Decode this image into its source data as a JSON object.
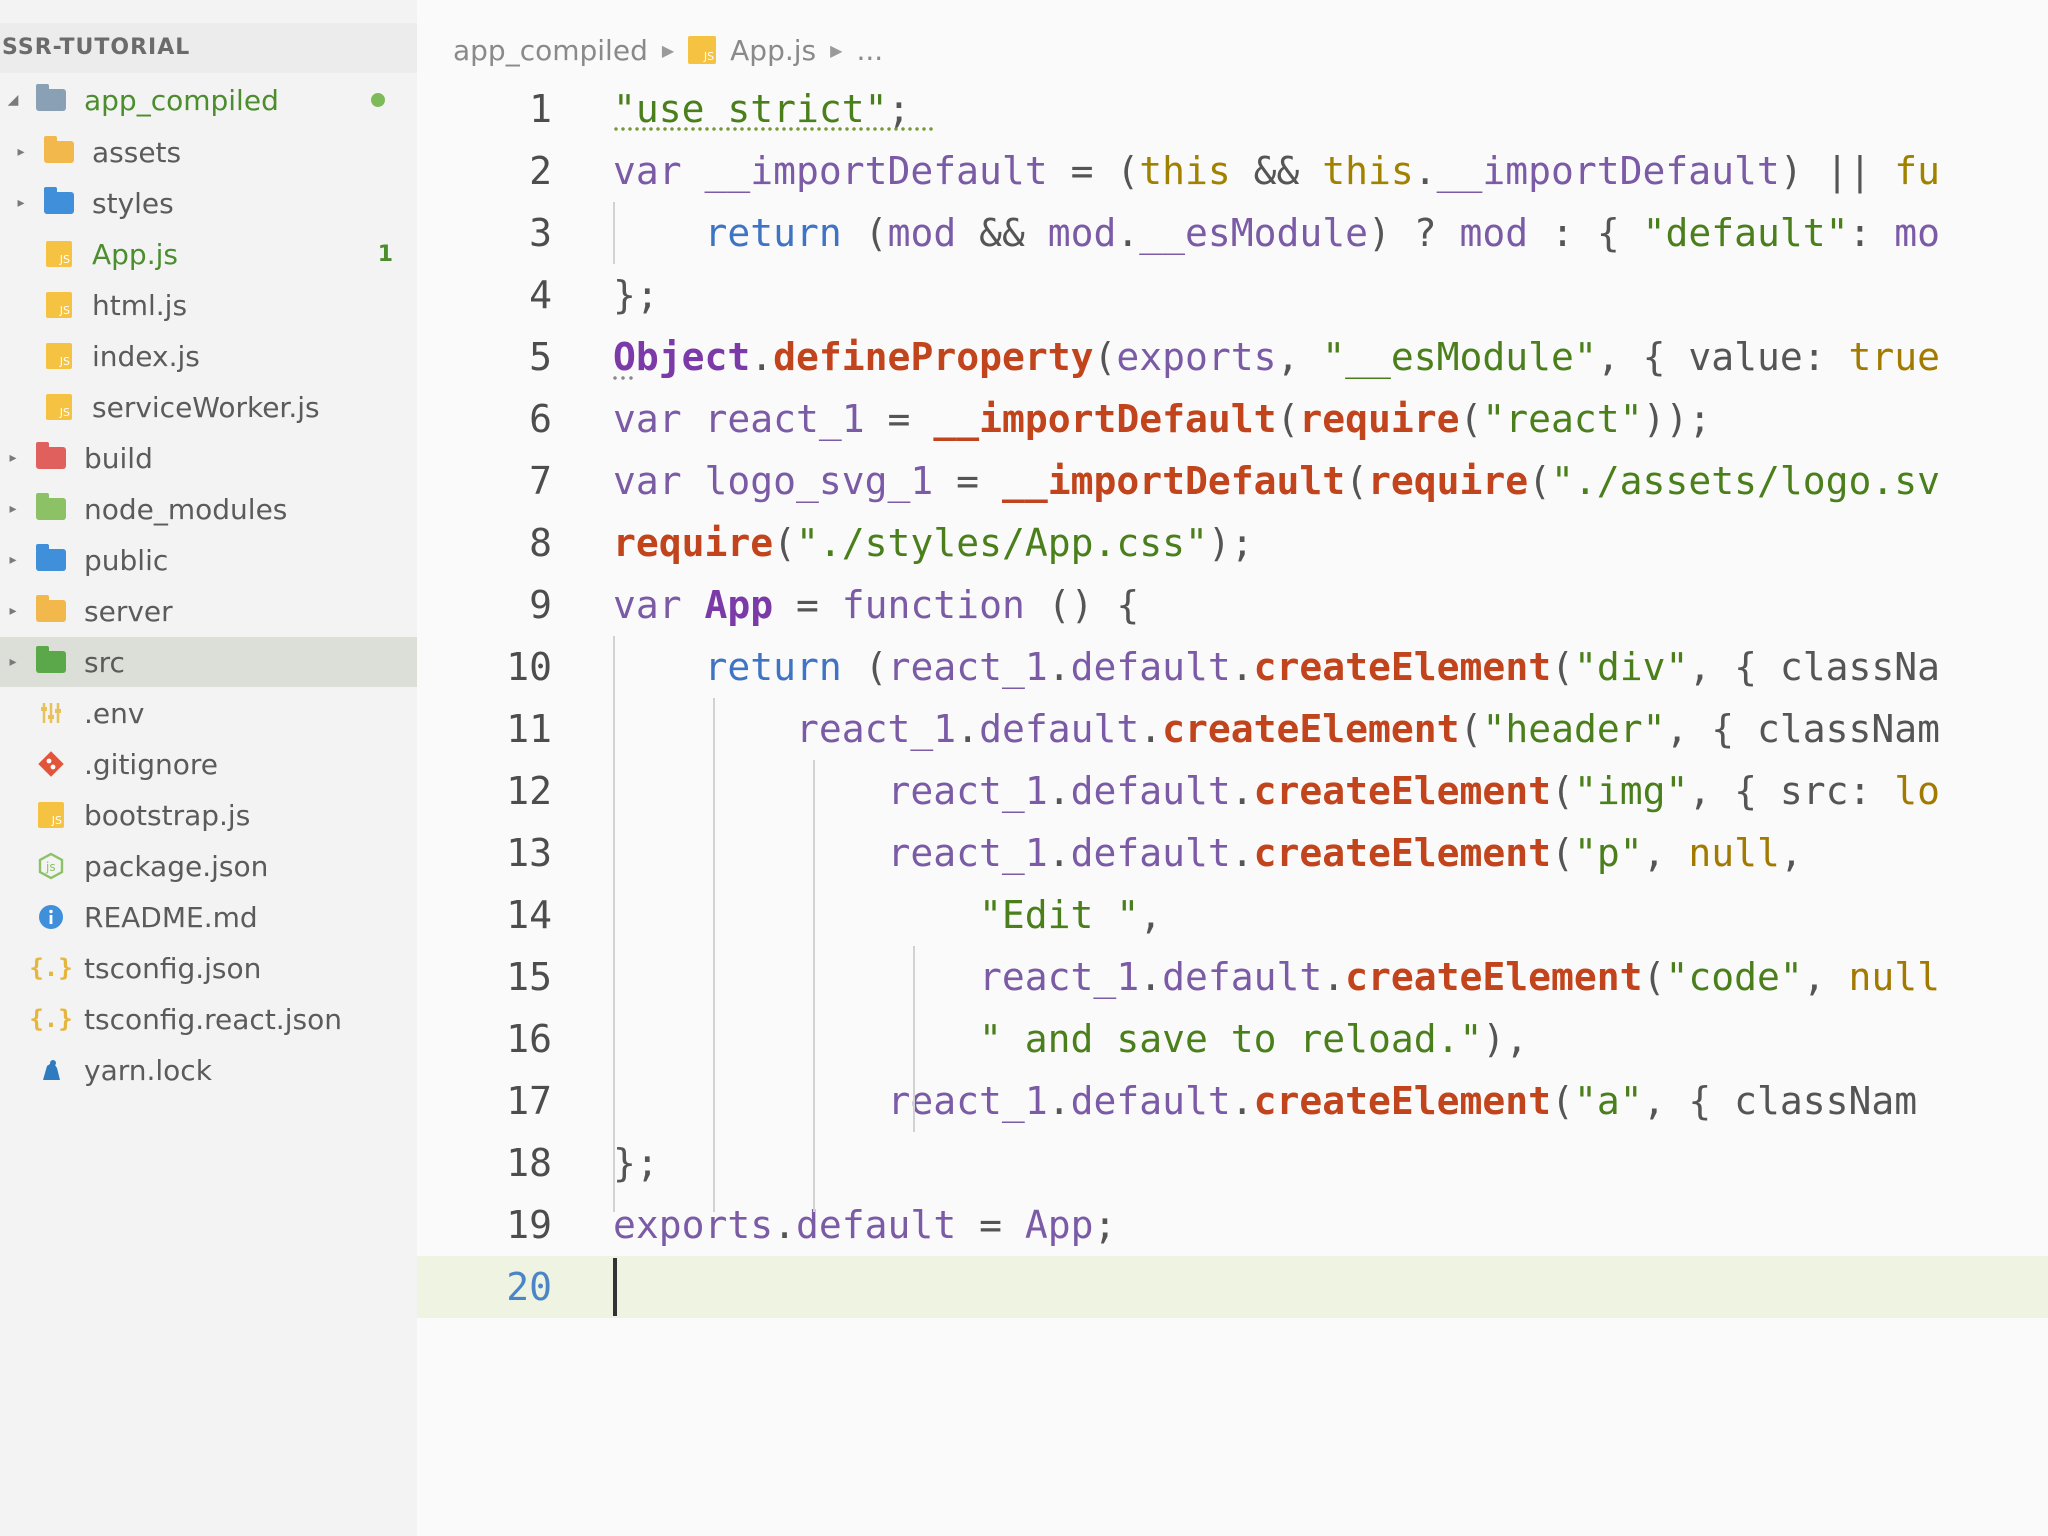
{
  "sidebar": {
    "title": "SSR-TUTORIAL",
    "items": [
      {
        "label": "app_compiled",
        "kind": "folder",
        "icon": "folder-open-icon",
        "color": "#8aa0b5",
        "expanded": true,
        "modified": true,
        "status": "dot"
      },
      {
        "label": "assets",
        "kind": "folder",
        "icon": "folder-assets-icon",
        "color": "#f2b84b"
      },
      {
        "label": "styles",
        "kind": "folder",
        "icon": "folder-styles-icon",
        "color": "#3f8fdb"
      },
      {
        "label": "App.js",
        "kind": "file",
        "icon": "js-file-icon",
        "modified": true,
        "badge": "1"
      },
      {
        "label": "html.js",
        "kind": "file",
        "icon": "js-file-icon"
      },
      {
        "label": "index.js",
        "kind": "file",
        "icon": "js-file-icon"
      },
      {
        "label": "serviceWorker.js",
        "kind": "file",
        "icon": "js-file-icon"
      },
      {
        "label": "build",
        "kind": "folder",
        "icon": "folder-build-icon",
        "color": "#e0605e"
      },
      {
        "label": "node_modules",
        "kind": "folder",
        "icon": "folder-node-icon",
        "color": "#8cc265"
      },
      {
        "label": "public",
        "kind": "folder",
        "icon": "folder-public-icon",
        "color": "#3f8fdb"
      },
      {
        "label": "server",
        "kind": "folder",
        "icon": "folder-server-icon",
        "color": "#f2b84b"
      },
      {
        "label": "src",
        "kind": "folder",
        "icon": "folder-src-icon",
        "color": "#5aa84a",
        "active": true
      },
      {
        "label": ".env",
        "kind": "file",
        "icon": "env-file-icon"
      },
      {
        "label": ".gitignore",
        "kind": "file",
        "icon": "git-icon"
      },
      {
        "label": "bootstrap.js",
        "kind": "file",
        "icon": "js-file-icon"
      },
      {
        "label": "package.json",
        "kind": "file",
        "icon": "npm-package-icon"
      },
      {
        "label": "README.md",
        "kind": "file",
        "icon": "info-icon"
      },
      {
        "label": "tsconfig.json",
        "kind": "file",
        "icon": "json-braces-icon"
      },
      {
        "label": "tsconfig.react.json",
        "kind": "file",
        "icon": "json-braces-icon"
      },
      {
        "label": "yarn.lock",
        "kind": "file",
        "icon": "yarn-icon"
      }
    ]
  },
  "breadcrumb": {
    "folder": "app_compiled",
    "file": "App.js",
    "tail": "..."
  },
  "editor": {
    "current_line": 20,
    "lines": [
      {
        "n": "1",
        "tokens": [
          [
            "str",
            "\"use strict\""
          ],
          [
            "pl",
            ";"
          ]
        ]
      },
      {
        "n": "2",
        "tokens": [
          [
            "kw",
            "var "
          ],
          [
            "id",
            "__importDefault"
          ],
          [
            "pl",
            " = ("
          ],
          [
            "this",
            "this"
          ],
          [
            "pl",
            " && "
          ],
          [
            "this",
            "this"
          ],
          [
            "pl",
            "."
          ],
          [
            "id",
            "__importDefault"
          ],
          [
            "pl",
            ") || "
          ],
          [
            "this",
            "fu"
          ]
        ]
      },
      {
        "n": "3",
        "tokens": [
          [
            "pl",
            "    "
          ],
          [
            "ret",
            "return"
          ],
          [
            "pl",
            " ("
          ],
          [
            "id",
            "mod"
          ],
          [
            "pl",
            " && "
          ],
          [
            "id",
            "mod"
          ],
          [
            "pl",
            "."
          ],
          [
            "id",
            "__esModule"
          ],
          [
            "pl",
            ") ? "
          ],
          [
            "id",
            "mod"
          ],
          [
            "pl",
            " : { "
          ],
          [
            "str",
            "\"default\""
          ],
          [
            "pl",
            ": "
          ],
          [
            "id",
            "mo"
          ]
        ]
      },
      {
        "n": "4",
        "tokens": [
          [
            "pl",
            "};"
          ]
        ]
      },
      {
        "n": "5",
        "tokens": [
          [
            "obj",
            "Object"
          ],
          [
            "pl",
            "."
          ],
          [
            "fn",
            "defineProperty"
          ],
          [
            "pl",
            "("
          ],
          [
            "id",
            "exports"
          ],
          [
            "pl",
            ", "
          ],
          [
            "str",
            "\"__esModule\""
          ],
          [
            "pl",
            ", { value: "
          ],
          [
            "lit",
            "true"
          ]
        ]
      },
      {
        "n": "6",
        "tokens": [
          [
            "kw",
            "var "
          ],
          [
            "id",
            "react_1"
          ],
          [
            "pl",
            " = "
          ],
          [
            "fn",
            "__importDefault"
          ],
          [
            "pl",
            "("
          ],
          [
            "fn",
            "require"
          ],
          [
            "pl",
            "("
          ],
          [
            "str",
            "\"react\""
          ],
          [
            "pl",
            "));"
          ]
        ]
      },
      {
        "n": "7",
        "tokens": [
          [
            "kw",
            "var "
          ],
          [
            "id",
            "logo_svg_1"
          ],
          [
            "pl",
            " = "
          ],
          [
            "fn",
            "__importDefault"
          ],
          [
            "pl",
            "("
          ],
          [
            "fn",
            "require"
          ],
          [
            "pl",
            "("
          ],
          [
            "str",
            "\"./assets/logo.sv"
          ]
        ]
      },
      {
        "n": "8",
        "tokens": [
          [
            "fn",
            "require"
          ],
          [
            "pl",
            "("
          ],
          [
            "str",
            "\"./styles/App.css\""
          ],
          [
            "pl",
            ");"
          ]
        ]
      },
      {
        "n": "9",
        "tokens": [
          [
            "kw",
            "var "
          ],
          [
            "obj",
            "App"
          ],
          [
            "pl",
            " = "
          ],
          [
            "kw",
            "function"
          ],
          [
            "pl",
            " () {"
          ]
        ]
      },
      {
        "n": "10",
        "tokens": [
          [
            "pl",
            "    "
          ],
          [
            "ret",
            "return"
          ],
          [
            "pl",
            " ("
          ],
          [
            "id",
            "react_1"
          ],
          [
            "pl",
            "."
          ],
          [
            "id",
            "default"
          ],
          [
            "pl",
            "."
          ],
          [
            "fn",
            "createElement"
          ],
          [
            "pl",
            "("
          ],
          [
            "str",
            "\"div\""
          ],
          [
            "pl",
            ", { classNa"
          ]
        ]
      },
      {
        "n": "11",
        "tokens": [
          [
            "pl",
            "        "
          ],
          [
            "id",
            "react_1"
          ],
          [
            "pl",
            "."
          ],
          [
            "id",
            "default"
          ],
          [
            "pl",
            "."
          ],
          [
            "fn",
            "createElement"
          ],
          [
            "pl",
            "("
          ],
          [
            "str",
            "\"header\""
          ],
          [
            "pl",
            ", { classNam"
          ]
        ]
      },
      {
        "n": "12",
        "tokens": [
          [
            "pl",
            "            "
          ],
          [
            "id",
            "react_1"
          ],
          [
            "pl",
            "."
          ],
          [
            "id",
            "default"
          ],
          [
            "pl",
            "."
          ],
          [
            "fn",
            "createElement"
          ],
          [
            "pl",
            "("
          ],
          [
            "str",
            "\"img\""
          ],
          [
            "pl",
            ", { src: "
          ],
          [
            "lit",
            "lo"
          ]
        ]
      },
      {
        "n": "13",
        "tokens": [
          [
            "pl",
            "            "
          ],
          [
            "id",
            "react_1"
          ],
          [
            "pl",
            "."
          ],
          [
            "id",
            "default"
          ],
          [
            "pl",
            "."
          ],
          [
            "fn",
            "createElement"
          ],
          [
            "pl",
            "("
          ],
          [
            "str",
            "\"p\""
          ],
          [
            "pl",
            ", "
          ],
          [
            "lit",
            "null"
          ],
          [
            "pl",
            ","
          ]
        ]
      },
      {
        "n": "14",
        "tokens": [
          [
            "pl",
            "                "
          ],
          [
            "str",
            "\"Edit \""
          ],
          [
            "pl",
            ","
          ]
        ]
      },
      {
        "n": "15",
        "tokens": [
          [
            "pl",
            "                "
          ],
          [
            "id",
            "react_1"
          ],
          [
            "pl",
            "."
          ],
          [
            "id",
            "default"
          ],
          [
            "pl",
            "."
          ],
          [
            "fn",
            "createElement"
          ],
          [
            "pl",
            "("
          ],
          [
            "str",
            "\"code\""
          ],
          [
            "pl",
            ", "
          ],
          [
            "lit",
            "null"
          ]
        ]
      },
      {
        "n": "16",
        "tokens": [
          [
            "pl",
            "                "
          ],
          [
            "str",
            "\" and save to reload.\""
          ],
          [
            "pl",
            "),"
          ]
        ]
      },
      {
        "n": "17",
        "tokens": [
          [
            "pl",
            "            "
          ],
          [
            "id",
            "react_1"
          ],
          [
            "pl",
            "."
          ],
          [
            "id",
            "default"
          ],
          [
            "pl",
            "."
          ],
          [
            "fn",
            "createElement"
          ],
          [
            "pl",
            "("
          ],
          [
            "str",
            "\"a\""
          ],
          [
            "pl",
            ", { classNam"
          ]
        ]
      },
      {
        "n": "18",
        "tokens": [
          [
            "pl",
            "};"
          ]
        ]
      },
      {
        "n": "19",
        "tokens": [
          [
            "id",
            "exports"
          ],
          [
            "pl",
            "."
          ],
          [
            "id",
            "default"
          ],
          [
            "pl",
            " = "
          ],
          [
            "id",
            "App"
          ],
          [
            "pl",
            ";"
          ]
        ]
      },
      {
        "n": "20",
        "tokens": []
      }
    ]
  }
}
